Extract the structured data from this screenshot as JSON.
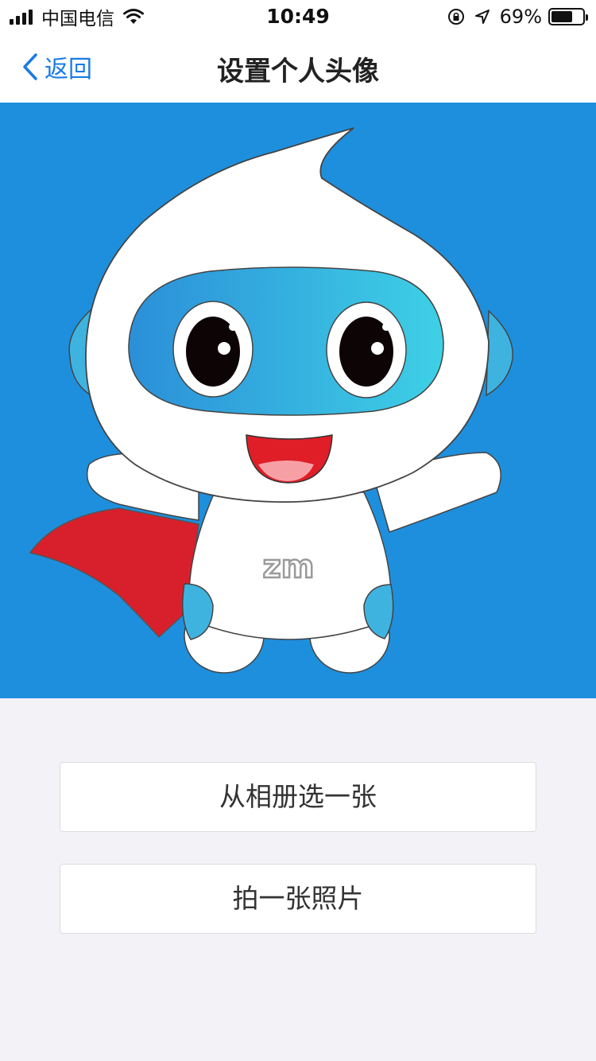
{
  "status_bar": {
    "carrier": "中国电信",
    "time": "10:49",
    "battery_percent": "69%",
    "battery_level": 0.69,
    "signal_bars": 4,
    "icons": [
      "signal-icon",
      "wifi-icon",
      "rotation-lock-icon",
      "location-arrow-icon",
      "battery-icon"
    ]
  },
  "nav": {
    "back_label": "返回",
    "title": "设置个人头像"
  },
  "avatar": {
    "icon": "robot-mascot-image",
    "mascot_logo_text": "zm",
    "background_color": "#1e8fdd"
  },
  "actions": {
    "choose_from_album": "从相册选一张",
    "take_photo": "拍一张照片"
  },
  "colors": {
    "accent": "#1a7be6",
    "page_background": "#f3f3f7"
  }
}
